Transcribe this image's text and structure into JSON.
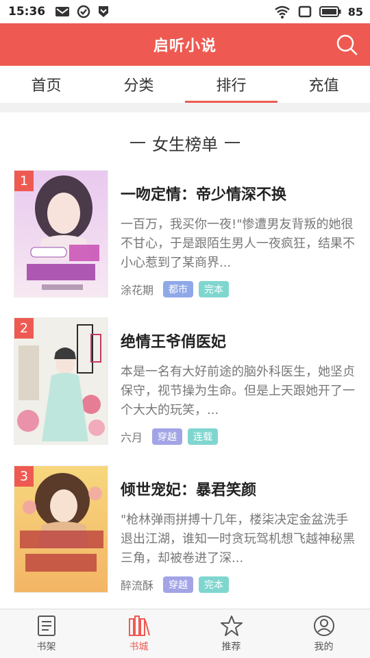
{
  "status_bar": {
    "time": "15:36",
    "battery": "85"
  },
  "header": {
    "title": "启听小说"
  },
  "tabs": [
    {
      "label": "首页"
    },
    {
      "label": "分类"
    },
    {
      "label": "排行"
    },
    {
      "label": "充值"
    }
  ],
  "active_tab": "排行",
  "section": {
    "title": "女生榜单"
  },
  "books": [
    {
      "rank": "1",
      "title": "一吻定情：帝少情深不换",
      "desc": "一百万，我买你一夜!\"惨遭男友背叛的她很不甘心，于是跟陌生男人一夜疯狂，结果不小心惹到了某商界...",
      "author": "涂花期",
      "tags": [
        {
          "text": "都市",
          "color": "#8fa8e8"
        },
        {
          "text": "完本",
          "color": "#7fd6cf"
        }
      ]
    },
    {
      "rank": "2",
      "title": "绝情王爷俏医妃",
      "desc": "本是一名有大好前途的脑外科医生，她坚贞保守，视节操为生命。但是上天跟她开了一个大大的玩笑，...",
      "author": "六月",
      "tags": [
        {
          "text": "穿越",
          "color": "#a2a4e6"
        },
        {
          "text": "连载",
          "color": "#7fd6cf"
        }
      ]
    },
    {
      "rank": "3",
      "title": "倾世宠妃：暴君笑颜",
      "desc": "\"枪林弹雨拼搏十几年，楼柒决定金盆洗手退出江湖，谁知一时贪玩驾机想飞越神秘黑三角，却被卷进了深...",
      "author": "醉流酥",
      "tags": [
        {
          "text": "穿越",
          "color": "#a2a4e6"
        },
        {
          "text": "完本",
          "color": "#7fd6cf"
        }
      ]
    }
  ],
  "bottom_nav": [
    {
      "label": "书架",
      "icon": "bookshelf-icon"
    },
    {
      "label": "书城",
      "icon": "bookstore-icon"
    },
    {
      "label": "推荐",
      "icon": "star-icon"
    },
    {
      "label": "我的",
      "icon": "user-icon"
    }
  ],
  "colors": {
    "accent": "#ee5a52"
  }
}
